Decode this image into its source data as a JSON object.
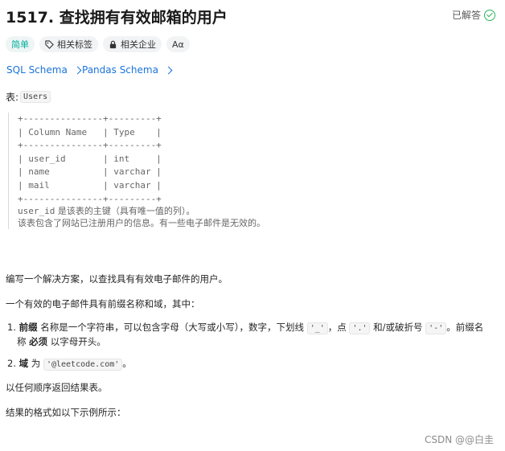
{
  "header": {
    "title": "1517. 查找拥有有效邮箱的用户",
    "solved": "已解答"
  },
  "tags": {
    "difficulty": "简单",
    "related_tags": "相关标签",
    "related_companies": "相关企业",
    "font_toggle": "Aα"
  },
  "schema_links": [
    {
      "label": "SQL Schema"
    },
    {
      "label": "Pandas Schema"
    }
  ],
  "table": {
    "prefix": "表:",
    "name": "Users"
  },
  "schema_block": "+---------------+---------+\n| Column Name   | Type    |\n+---------------+---------+\n| user_id       | int     |\n| name          | varchar |\n| mail          | varchar |\n+---------------+---------+",
  "notes": {
    "line1_code": "user_id",
    "line1_text": " 是该表的主键（具有唯一值的列）。",
    "line2": "该表包含了网站已注册用户的信息。有一些电子邮件是无效的。"
  },
  "body": {
    "p1": "编写一个解决方案，以查找具有有效电子邮件的用户。",
    "p2": "一个有效的电子邮件具有前缀名称和域，其中：",
    "item1": {
      "num": "1.",
      "bold": "前缀",
      "t1": " 名称是一个字符串，可以包含字母（大写或小写），数字，下划线 ",
      "c1": "'_'",
      "t2": "，点 ",
      "c2": "'.'",
      "t3": " 和/或破折号 ",
      "c3": "'-'",
      "t4": "。前缀名",
      "t5": "称 ",
      "bold2": "必须",
      "t6": " 以字母开头。"
    },
    "item2": {
      "num": "2.",
      "bold": "域",
      "t1": " 为 ",
      "c1": "'@leetcode.com'",
      "t2": "。"
    },
    "p3": "以任何顺序返回结果表。",
    "p4": "结果的格式如以下示例所示："
  },
  "watermark": "CSDN @@白圭",
  "colors": {
    "accent_easy": "#00af9b",
    "link": "#1a73d9",
    "solved_check": "#2db55d"
  }
}
